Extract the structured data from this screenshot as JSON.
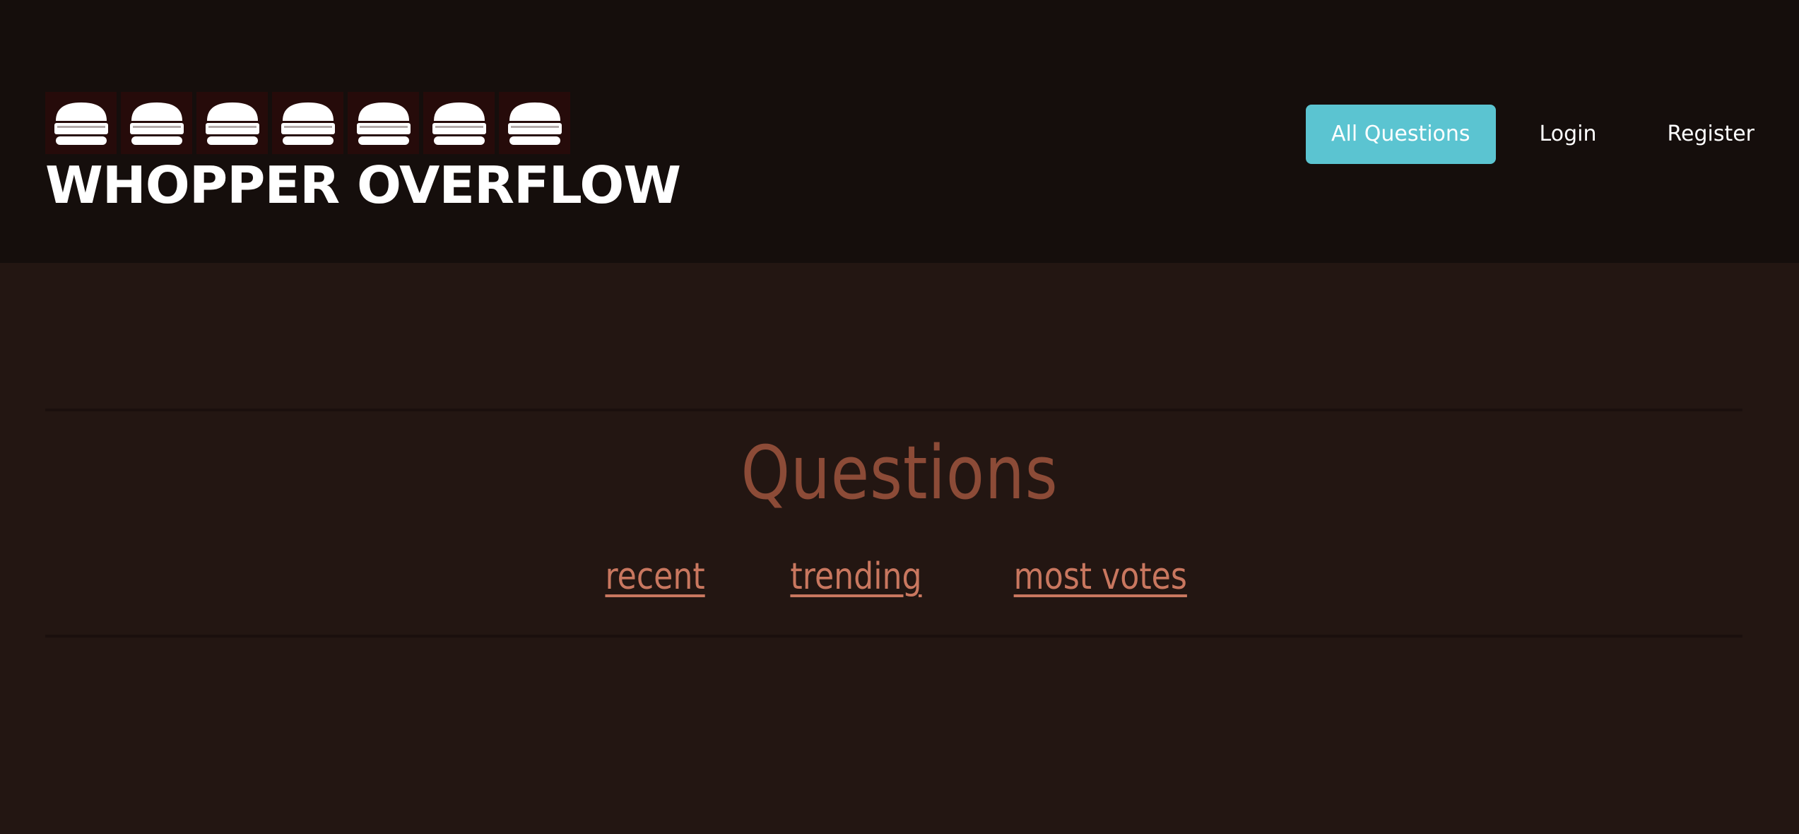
{
  "header": {
    "logo_text": "WHOPPER OVERFLOW",
    "burger_icon_count": 7,
    "burger_icon": "burger-icon"
  },
  "nav": {
    "all_questions": "All Questions",
    "login": "Login",
    "register": "Register"
  },
  "main": {
    "title": "Questions",
    "sort_links": {
      "recent": "recent",
      "trending": "trending",
      "most_votes": "most votes"
    }
  },
  "colors": {
    "header_bg": "#150e0c",
    "page_bg": "#231612",
    "accent": "#5bc4d1",
    "title": "#8c4b37",
    "link": "#c9775f"
  }
}
